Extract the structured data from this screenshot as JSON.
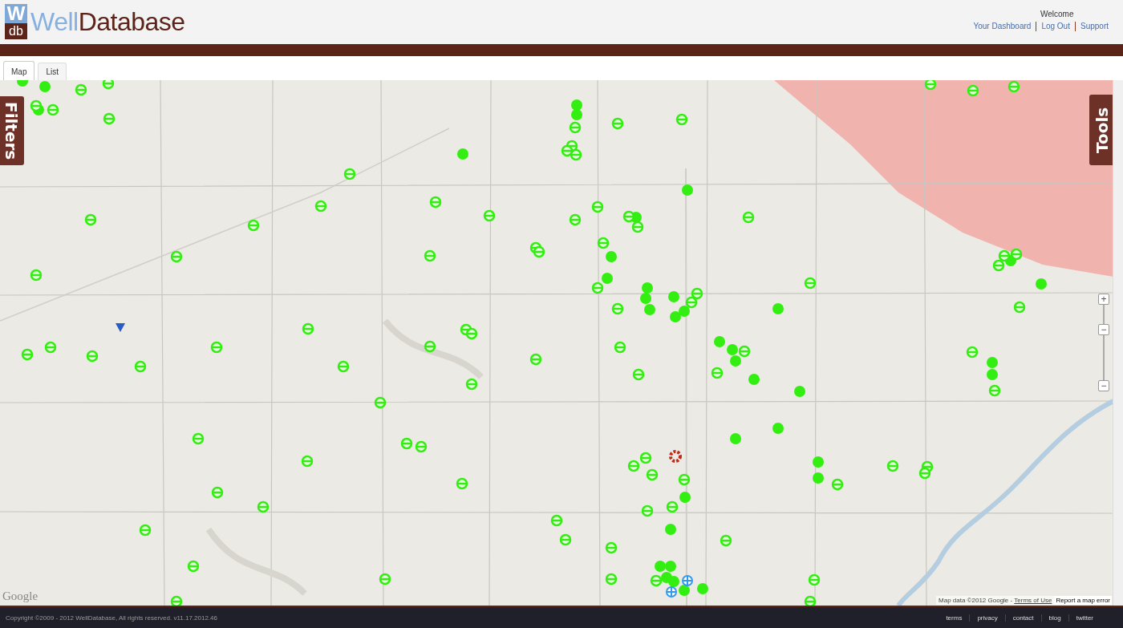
{
  "header": {
    "logo": {
      "mark_top": "W",
      "mark_bottom": "db",
      "name_first": "Well",
      "name_second": "Database"
    },
    "welcome": "Welcome",
    "links": [
      "Your Dashboard",
      "Log Out",
      "Support"
    ]
  },
  "tabs": [
    {
      "label": "Map",
      "selected": true
    },
    {
      "label": "List",
      "selected": false
    }
  ],
  "map": {
    "kind": "picture",
    "filters_tab": "Filters",
    "tools_tab": "Tools",
    "zoom": {
      "in": "+",
      "out": "−",
      "thumb": "−",
      "level": 0.7
    },
    "google_logo": "Google",
    "attribution": "Map data ©2012 Google - ",
    "terms_link": "Terms of Use",
    "report_button": "Report a map error"
  },
  "footer": {
    "copyright": "Copyright ©2009 - 2012 WellDatabase, All rights reserved. v11.17.2012.46",
    "links": [
      "terms",
      "privacy",
      "contact",
      "blog",
      "twitter"
    ]
  }
}
